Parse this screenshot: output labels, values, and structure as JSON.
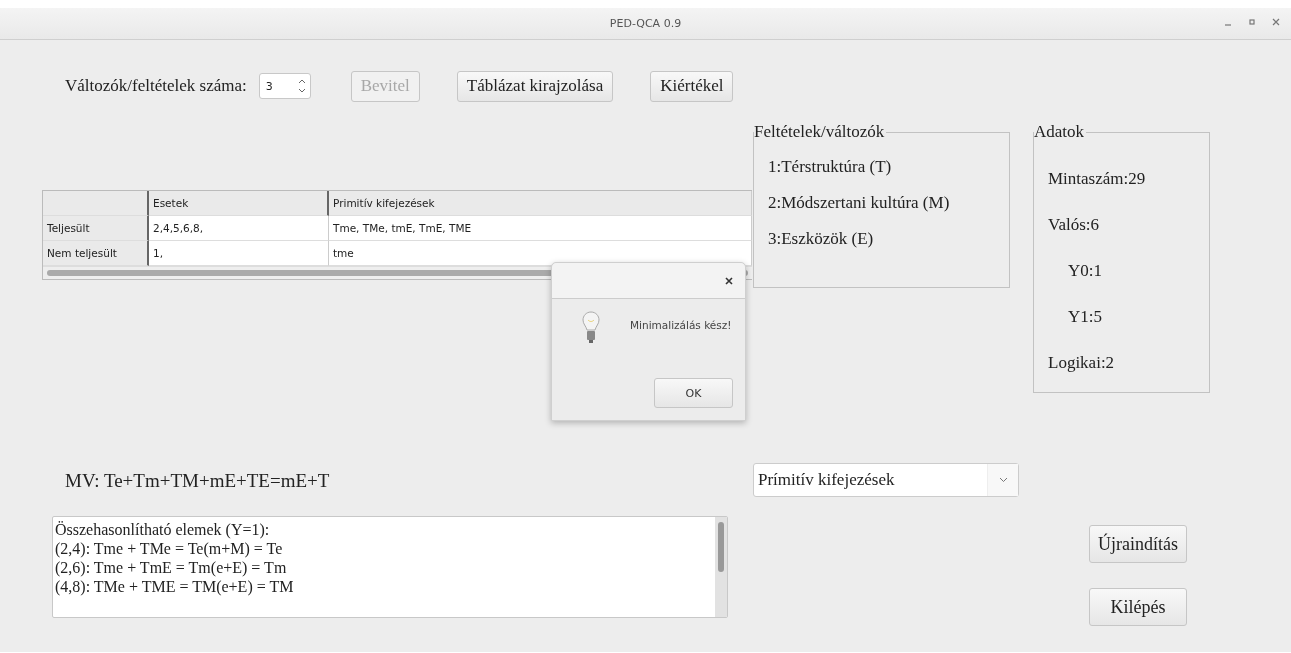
{
  "window": {
    "title": "PED-QCA 0.9"
  },
  "toolbar": {
    "count_label": "Változók/feltételek száma:",
    "count_value": "3",
    "buttons": [
      {
        "label": "Bevitel",
        "disabled": true
      },
      {
        "label": "Táblázat kirajzolása",
        "disabled": false
      },
      {
        "label": "Kiértékel",
        "disabled": false
      }
    ]
  },
  "table": {
    "columns": [
      "Esetek",
      "Primitív kifejezések"
    ],
    "rows": [
      {
        "header": "Teljesült",
        "cells": [
          "2,4,5,6,8,",
          "Tme, TMe, tmE, TmE, TME"
        ]
      },
      {
        "header": "Nem teljesült",
        "cells": [
          "1,",
          "tme"
        ]
      }
    ]
  },
  "conditions": {
    "title": "Feltételek/változók",
    "items": [
      "1:Térstruktúra (T)",
      "2:Módszertani kultúra (M)",
      "3:Eszközök (E)"
    ]
  },
  "data": {
    "title": "Adatok",
    "items": [
      {
        "text": "Mintaszám:29",
        "kind": "main"
      },
      {
        "text": "Valós:6",
        "kind": "main"
      },
      {
        "text": "Y0:1",
        "kind": "sub"
      },
      {
        "text": "Y1:5",
        "kind": "sub"
      },
      {
        "text": "Logikai:2",
        "kind": "main"
      }
    ]
  },
  "formula": "MV: Te+Tm+TM+mE+TE=mE+T",
  "view_select": {
    "value": "Prímitív kifejezések"
  },
  "output": {
    "lines": [
      "Összehasonlítható elemek (Y=1):",
      "(2,4): Tme + TMe = Te(m+M) = Te",
      "(2,6): Tme + TmE = Tm(e+E) = Tm",
      "(4,8): TMe + TME = TM(e+E) = TM"
    ]
  },
  "actions": [
    "Újraindítás",
    "Kilépés"
  ],
  "dialog": {
    "message": "Minimalizálás kész!",
    "button": "OK"
  }
}
